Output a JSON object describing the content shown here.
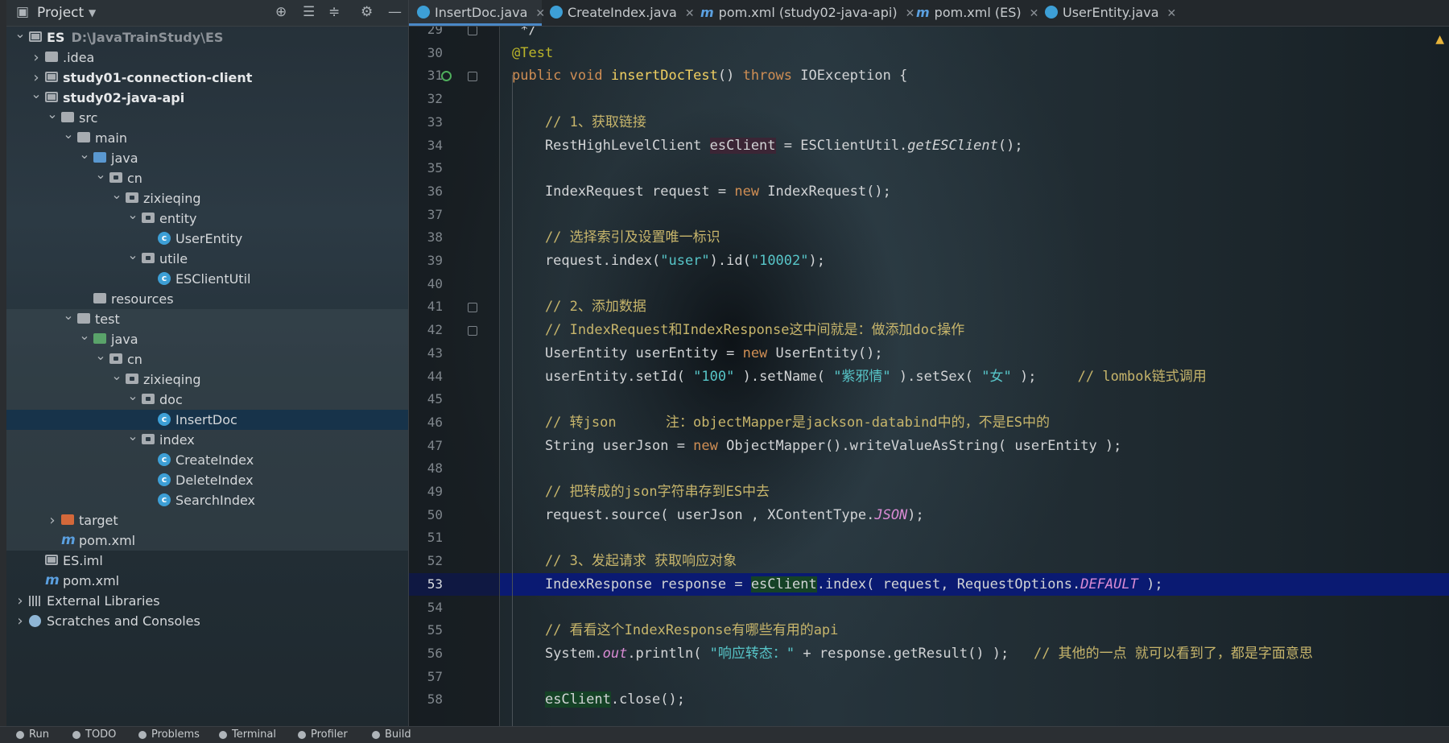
{
  "project_panel": {
    "title": "Project",
    "tree": [
      {
        "label": "ES",
        "path": "D:\\JavaTrainStudy\\ES",
        "depth": 0,
        "expanded": true,
        "icon": "module",
        "bold": true
      },
      {
        "label": ".idea",
        "depth": 1,
        "expanded": false,
        "icon": "folder"
      },
      {
        "label": "study01-connection-client",
        "depth": 1,
        "expanded": false,
        "icon": "module",
        "bold": true
      },
      {
        "label": "study02-java-api",
        "depth": 1,
        "expanded": true,
        "icon": "module",
        "bold": true
      },
      {
        "label": "src",
        "depth": 2,
        "expanded": true,
        "icon": "folder"
      },
      {
        "label": "main",
        "depth": 3,
        "expanded": true,
        "icon": "folder"
      },
      {
        "label": "java",
        "depth": 4,
        "expanded": true,
        "icon": "folder-blue"
      },
      {
        "label": "cn",
        "depth": 5,
        "expanded": true,
        "icon": "package"
      },
      {
        "label": "zixieqing",
        "depth": 6,
        "expanded": true,
        "icon": "package"
      },
      {
        "label": "entity",
        "depth": 7,
        "expanded": true,
        "icon": "package"
      },
      {
        "label": "UserEntity",
        "depth": 8,
        "icon": "class"
      },
      {
        "label": "utile",
        "depth": 7,
        "expanded": true,
        "icon": "package"
      },
      {
        "label": "ESClientUtil",
        "depth": 8,
        "icon": "class"
      },
      {
        "label": "resources",
        "depth": 4,
        "icon": "folder"
      },
      {
        "label": "test",
        "depth": 3,
        "expanded": true,
        "icon": "folder"
      },
      {
        "label": "java",
        "depth": 4,
        "expanded": true,
        "icon": "folder-green"
      },
      {
        "label": "cn",
        "depth": 5,
        "expanded": true,
        "icon": "package"
      },
      {
        "label": "zixieqing",
        "depth": 6,
        "expanded": true,
        "icon": "package"
      },
      {
        "label": "doc",
        "depth": 7,
        "expanded": true,
        "icon": "package"
      },
      {
        "label": "InsertDoc",
        "depth": 8,
        "icon": "class",
        "selected": true
      },
      {
        "label": "index",
        "depth": 7,
        "expanded": true,
        "icon": "package"
      },
      {
        "label": "CreateIndex",
        "depth": 8,
        "icon": "class"
      },
      {
        "label": "DeleteIndex",
        "depth": 8,
        "icon": "class"
      },
      {
        "label": "SearchIndex",
        "depth": 8,
        "icon": "class"
      },
      {
        "label": "target",
        "depth": 2,
        "expanded": false,
        "icon": "folder-orange"
      },
      {
        "label": "pom.xml",
        "depth": 2,
        "icon": "maven"
      },
      {
        "label": "ES.iml",
        "depth": 1,
        "icon": "file"
      },
      {
        "label": "pom.xml",
        "depth": 1,
        "icon": "maven"
      },
      {
        "label": "External Libraries",
        "depth": 0,
        "expanded": false,
        "icon": "library"
      },
      {
        "label": "Scratches and Consoles",
        "depth": 0,
        "expanded": false,
        "icon": "scratch"
      }
    ]
  },
  "tabs": [
    {
      "label": "InsertDoc.java",
      "icon": "class",
      "active": true
    },
    {
      "label": "CreateIndex.java",
      "icon": "class"
    },
    {
      "label": "pom.xml (study02-java-api)",
      "icon": "maven"
    },
    {
      "label": "pom.xml (ES)",
      "icon": "maven"
    },
    {
      "label": "UserEntity.java",
      "icon": "class"
    }
  ],
  "editor": {
    "current_line": 53,
    "lines": [
      {
        "n": 29,
        "segs": [
          [
            " */",
            "plain"
          ]
        ],
        "fold": true
      },
      {
        "n": 30,
        "segs": [
          [
            "@Test",
            "an"
          ]
        ]
      },
      {
        "n": 31,
        "segs": [
          [
            "public void ",
            "kw"
          ],
          [
            "insertDocTest",
            "fn"
          ],
          [
            "() ",
            "plain"
          ],
          [
            "throws ",
            "kw"
          ],
          [
            "IOException {",
            "plain"
          ]
        ],
        "fold": true,
        "run": true
      },
      {
        "n": 32,
        "segs": []
      },
      {
        "n": 33,
        "segs": [
          [
            "    // 1、获取链接",
            "cm"
          ]
        ]
      },
      {
        "n": 34,
        "segs": [
          [
            "    RestHighLevelClient ",
            "plain"
          ],
          [
            "esClient",
            "hl1"
          ],
          [
            " = ESClientUtil.",
            "plain"
          ],
          [
            "getESClient",
            "itw"
          ],
          [
            "();",
            "plain"
          ]
        ]
      },
      {
        "n": 35,
        "segs": []
      },
      {
        "n": 36,
        "segs": [
          [
            "    IndexRequest request = ",
            "plain"
          ],
          [
            "new ",
            "kw"
          ],
          [
            "IndexRequest();",
            "plain"
          ]
        ]
      },
      {
        "n": 37,
        "segs": []
      },
      {
        "n": 38,
        "segs": [
          [
            "    // 选择索引及设置唯一标识",
            "cm"
          ]
        ]
      },
      {
        "n": 39,
        "segs": [
          [
            "    request.index(",
            "plain"
          ],
          [
            "\"user\"",
            "st"
          ],
          [
            ").id(",
            "plain"
          ],
          [
            "\"10002\"",
            "st"
          ],
          [
            ");",
            "plain"
          ]
        ]
      },
      {
        "n": 40,
        "segs": []
      },
      {
        "n": 41,
        "segs": [
          [
            "    // 2、添加数据",
            "cm"
          ]
        ],
        "fold": true
      },
      {
        "n": 42,
        "segs": [
          [
            "    // IndexRequest和IndexResponse这中间就是：做添加doc操作",
            "cm"
          ]
        ],
        "fold": true
      },
      {
        "n": 43,
        "segs": [
          [
            "    UserEntity userEntity = ",
            "plain"
          ],
          [
            "new ",
            "kw"
          ],
          [
            "UserEntity();",
            "plain"
          ]
        ]
      },
      {
        "n": 44,
        "segs": [
          [
            "    userEntity.setId( ",
            "plain"
          ],
          [
            "\"100\"",
            "st"
          ],
          [
            " ).setName( ",
            "plain"
          ],
          [
            "\"紫邪情\"",
            "st"
          ],
          [
            " ).setSex( ",
            "plain"
          ],
          [
            "\"女\"",
            "st"
          ],
          [
            " );     ",
            "plain"
          ],
          [
            "// lombok链式调用",
            "cm"
          ]
        ]
      },
      {
        "n": 45,
        "segs": []
      },
      {
        "n": 46,
        "segs": [
          [
            "    // 转json      注：objectMapper是jackson-databind中的，不是ES中的",
            "cm"
          ]
        ]
      },
      {
        "n": 47,
        "segs": [
          [
            "    String userJson = ",
            "plain"
          ],
          [
            "new ",
            "kw"
          ],
          [
            "ObjectMapper().writeValueAsString( userEntity );",
            "plain"
          ]
        ]
      },
      {
        "n": 48,
        "segs": []
      },
      {
        "n": 49,
        "segs": [
          [
            "    // 把转成的json字符串存到ES中去",
            "cm"
          ]
        ]
      },
      {
        "n": 50,
        "segs": [
          [
            "    request.source( userJson , XContentType.",
            "plain"
          ],
          [
            "JSON",
            "it"
          ],
          [
            ");",
            "plain"
          ]
        ]
      },
      {
        "n": 51,
        "segs": []
      },
      {
        "n": 52,
        "segs": [
          [
            "    // 3、发起请求 获取响应对象",
            "cm"
          ]
        ]
      },
      {
        "n": 53,
        "segs": [
          [
            "    IndexResponse response = ",
            "plain"
          ],
          [
            "esClient",
            "hl2"
          ],
          [
            ".index( request, RequestOptions.",
            "plain"
          ],
          [
            "DEFAULT",
            "it"
          ],
          [
            " );",
            "plain"
          ]
        ]
      },
      {
        "n": 54,
        "segs": []
      },
      {
        "n": 55,
        "segs": [
          [
            "    // 看看这个IndexResponse有哪些有用的api",
            "cm"
          ]
        ]
      },
      {
        "n": 56,
        "segs": [
          [
            "    System.",
            "plain"
          ],
          [
            "out",
            "it"
          ],
          [
            ".println( ",
            "plain"
          ],
          [
            "\"响应转态：\"",
            "st"
          ],
          [
            " + response.getResult() );   ",
            "plain"
          ],
          [
            "// 其他的一点 就可以看到了，都是字面意思",
            "cm"
          ]
        ]
      },
      {
        "n": 57,
        "segs": []
      },
      {
        "n": 58,
        "segs": [
          [
            "    ",
            "plain"
          ],
          [
            "esClient",
            "hl2"
          ],
          [
            ".close();",
            "plain"
          ]
        ]
      }
    ]
  },
  "status_bar": [
    {
      "label": "Run",
      "icon": "run-icon"
    },
    {
      "label": "TODO",
      "icon": "todo-icon"
    },
    {
      "label": "Problems",
      "icon": "problems-icon"
    },
    {
      "label": "Terminal",
      "icon": "terminal-icon"
    },
    {
      "label": "Profiler",
      "icon": "profiler-icon"
    },
    {
      "label": "Build",
      "icon": "build-icon"
    }
  ]
}
